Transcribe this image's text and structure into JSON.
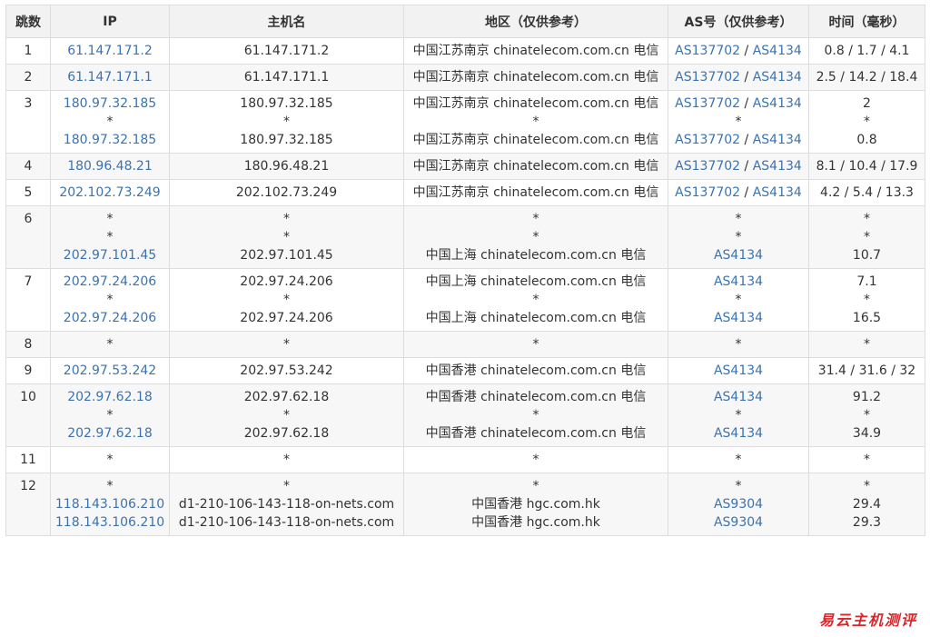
{
  "headers": [
    "跳数",
    "IP",
    "主机名",
    "地区（仅供参考）",
    "AS号（仅供参考）",
    "时间（毫秒）"
  ],
  "rows": [
    {
      "hop": "1",
      "ip": [
        "61.147.171.2"
      ],
      "host": [
        "61.147.171.2"
      ],
      "region": [
        "中国江苏南京 chinatelecom.com.cn 电信"
      ],
      "as": [
        [
          "AS137702",
          "AS4134"
        ]
      ],
      "time": [
        "0.8 / 1.7 / 4.1"
      ]
    },
    {
      "hop": "2",
      "ip": [
        "61.147.171.1"
      ],
      "host": [
        "61.147.171.1"
      ],
      "region": [
        "中国江苏南京 chinatelecom.com.cn 电信"
      ],
      "as": [
        [
          "AS137702",
          "AS4134"
        ]
      ],
      "time": [
        "2.5 / 14.2 / 18.4"
      ]
    },
    {
      "hop": "3",
      "ip": [
        "180.97.32.185",
        "*",
        "180.97.32.185"
      ],
      "host": [
        "180.97.32.185",
        "*",
        "180.97.32.185"
      ],
      "region": [
        "中国江苏南京 chinatelecom.com.cn 电信",
        "*",
        "中国江苏南京 chinatelecom.com.cn 电信"
      ],
      "as": [
        [
          "AS137702",
          "AS4134"
        ],
        [
          "*"
        ],
        [
          "AS137702",
          "AS4134"
        ]
      ],
      "time": [
        "2",
        "*",
        "0.8"
      ]
    },
    {
      "hop": "4",
      "ip": [
        "180.96.48.21"
      ],
      "host": [
        "180.96.48.21"
      ],
      "region": [
        "中国江苏南京 chinatelecom.com.cn 电信"
      ],
      "as": [
        [
          "AS137702",
          "AS4134"
        ]
      ],
      "time": [
        "8.1 / 10.4 / 17.9"
      ]
    },
    {
      "hop": "5",
      "ip": [
        "202.102.73.249"
      ],
      "host": [
        "202.102.73.249"
      ],
      "region": [
        "中国江苏南京 chinatelecom.com.cn 电信"
      ],
      "as": [
        [
          "AS137702",
          "AS4134"
        ]
      ],
      "time": [
        "4.2 / 5.4 / 13.3"
      ]
    },
    {
      "hop": "6",
      "ip": [
        "*",
        "*",
        "202.97.101.45"
      ],
      "host": [
        "*",
        "*",
        "202.97.101.45"
      ],
      "region": [
        "*",
        "*",
        "中国上海 chinatelecom.com.cn 电信"
      ],
      "as": [
        [
          "*"
        ],
        [
          "*"
        ],
        [
          "AS4134"
        ]
      ],
      "time": [
        "*",
        "*",
        "10.7"
      ]
    },
    {
      "hop": "7",
      "ip": [
        "202.97.24.206",
        "*",
        "202.97.24.206"
      ],
      "host": [
        "202.97.24.206",
        "*",
        "202.97.24.206"
      ],
      "region": [
        "中国上海 chinatelecom.com.cn 电信",
        "*",
        "中国上海 chinatelecom.com.cn 电信"
      ],
      "as": [
        [
          "AS4134"
        ],
        [
          "*"
        ],
        [
          "AS4134"
        ]
      ],
      "time": [
        "7.1",
        "*",
        "16.5"
      ]
    },
    {
      "hop": "8",
      "ip": [
        "*"
      ],
      "host": [
        "*"
      ],
      "region": [
        "*"
      ],
      "as": [
        [
          "*"
        ]
      ],
      "time": [
        "*"
      ]
    },
    {
      "hop": "9",
      "ip": [
        "202.97.53.242"
      ],
      "host": [
        "202.97.53.242"
      ],
      "region": [
        "中国香港 chinatelecom.com.cn 电信"
      ],
      "as": [
        [
          "AS4134"
        ]
      ],
      "time": [
        "31.4 / 31.6 / 32"
      ]
    },
    {
      "hop": "10",
      "ip": [
        "202.97.62.18",
        "*",
        "202.97.62.18"
      ],
      "host": [
        "202.97.62.18",
        "*",
        "202.97.62.18"
      ],
      "region": [
        "中国香港 chinatelecom.com.cn 电信",
        "*",
        "中国香港 chinatelecom.com.cn 电信"
      ],
      "as": [
        [
          "AS4134"
        ],
        [
          "*"
        ],
        [
          "AS4134"
        ]
      ],
      "time": [
        "91.2",
        "*",
        "34.9"
      ]
    },
    {
      "hop": "11",
      "ip": [
        "*"
      ],
      "host": [
        "*"
      ],
      "region": [
        "*"
      ],
      "as": [
        [
          "*"
        ]
      ],
      "time": [
        "*"
      ]
    },
    {
      "hop": "12",
      "ip": [
        "*",
        "118.143.106.210",
        "118.143.106.210"
      ],
      "host": [
        "*",
        "d1-210-106-143-118-on-nets.com",
        "d1-210-106-143-118-on-nets.com"
      ],
      "region": [
        "*",
        "中国香港 hgc.com.hk",
        "中国香港 hgc.com.hk"
      ],
      "as": [
        [
          "*"
        ],
        [
          "AS9304"
        ],
        [
          "AS9304"
        ]
      ],
      "time": [
        "*",
        "29.4",
        "29.3"
      ]
    }
  ],
  "watermark": "易云主机测评"
}
